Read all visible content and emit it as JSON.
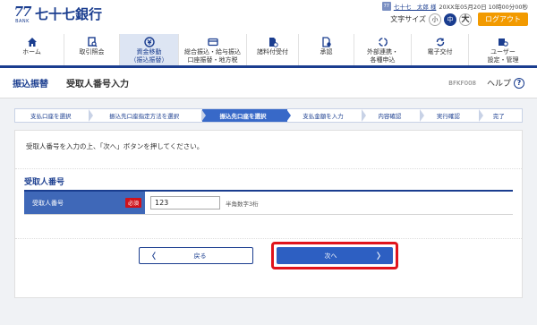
{
  "header": {
    "bank_mark": "77",
    "bank_mark_sub": "BANK",
    "bank_name": "七十七銀行",
    "user_icon": "77",
    "user_name": "七十七　太郎 様",
    "login_time": "20XX年05月20日 10時00分00秒",
    "font_size_label": "文字サイズ",
    "font_sizes": [
      "小",
      "中",
      "大"
    ],
    "logout_label": "ログアウト"
  },
  "nav": [
    {
      "label1": "ホーム",
      "label2": "",
      "icon": "home-icon"
    },
    {
      "label1": "取引照会",
      "label2": "",
      "icon": "document-search-icon"
    },
    {
      "label1": "資金移動",
      "label2": "（振込振替）",
      "icon": "transfer-icon",
      "active": true
    },
    {
      "label1": "総合振込・給与振込",
      "label2": "口座振替・地方税",
      "icon": "card-icon"
    },
    {
      "label1": "諸料付受付",
      "label2": "",
      "icon": "person-document-icon"
    },
    {
      "label1": "承認",
      "label2": "",
      "icon": "approval-icon"
    },
    {
      "label1": "外部連携・",
      "label2": "各種申込",
      "icon": "link-icon"
    },
    {
      "label1": "電子交付",
      "label2": "",
      "icon": "cycle-icon"
    },
    {
      "label1": "ユーザー",
      "label2": "設定・管理",
      "icon": "user-settings-icon"
    }
  ],
  "page": {
    "category": "振込振替",
    "title": "受取人番号入力",
    "screen_code": "BFKF008",
    "help_label": "ヘルプ",
    "help_icon": "?"
  },
  "steps": [
    "支払口座を選択",
    "振込先口座指定方法を選択",
    "振込先口座を選択",
    "支払金額を入力",
    "内容確認",
    "実行確認",
    "完了"
  ],
  "current_step": 2,
  "form": {
    "instruction": "受取人番号を入力の上、「次へ」ボタンを押してください。",
    "section_title": "受取人番号",
    "field_label": "受取人番号",
    "required_label": "必須",
    "field_value": "123",
    "field_hint": "半角数字3桁"
  },
  "buttons": {
    "back_label": "戻る",
    "next_label": "次へ",
    "back_chevron": "〈",
    "next_chevron": "〉"
  },
  "colors": {
    "brand": "#1a3d8f",
    "accent_orange": "#f29a00",
    "required_red": "#d0121b",
    "highlight_red": "#e0141c",
    "step_current": "#3869c8"
  }
}
